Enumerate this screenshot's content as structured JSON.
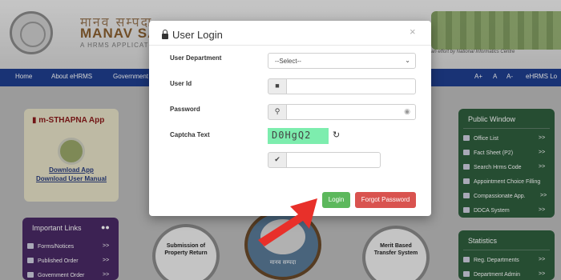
{
  "header": {
    "hindi_title": "मानव सम्पदा",
    "brand": "MANAV SAM",
    "brand_sub": "A HRMS APPLICATI",
    "tagline": "an effort by National Informatics Centre"
  },
  "nav": {
    "items": [
      "Home",
      "About eHRMS",
      "Government"
    ],
    "right": [
      "A+",
      "A",
      "A-",
      "eHRMS Lo"
    ]
  },
  "mst": {
    "title": "m-STHAPNA App",
    "download_app": "Download App",
    "download_manual": "Download User Manual"
  },
  "important_links": {
    "title": "Important Links",
    "items": [
      "Forms/Notices",
      "Published Order",
      "Government Order"
    ],
    "arrow": ">>"
  },
  "public_window": {
    "title": "Public Window",
    "items": [
      "Office List",
      "Fact Sheet (P2)",
      "Search Hrms Code",
      "Appointment Choice Filling",
      "Compassionate App.",
      "DDCA System"
    ],
    "arrow": ">>"
  },
  "statistics": {
    "title": "Statistics",
    "items": [
      "Reg. Departments",
      "Department Admin"
    ],
    "arrow": ">>"
  },
  "circles": {
    "property": "Submission of Property Return",
    "transfer": "Merit Based Transfer System",
    "center_hindi": "मानव सम्पदा"
  },
  "modal": {
    "title": "User Login",
    "close": "×",
    "dept_label": "User Department",
    "dept_value": "--Select--",
    "userid_label": "User Id",
    "userid_value": "",
    "password_label": "Password",
    "password_value": "",
    "captcha_label": "Captcha Text",
    "captcha_value": "D0HgQ2",
    "captcha_input": "",
    "login": "Login",
    "forgot": "Forgot Password"
  },
  "colors": {
    "navbar": "#1f3f8f",
    "login_button": "#5cb85c",
    "forgot_button": "#d9534f",
    "captcha_bg": "#7dedae",
    "arrow": "#e8302a"
  },
  "icons": {
    "lock": "lock-icon",
    "user": "user-icon",
    "key": "key-icon",
    "eye": "eye-icon",
    "refresh": "refresh-icon",
    "check": "check-icon",
    "arrow": "arrow-pointer-icon"
  }
}
